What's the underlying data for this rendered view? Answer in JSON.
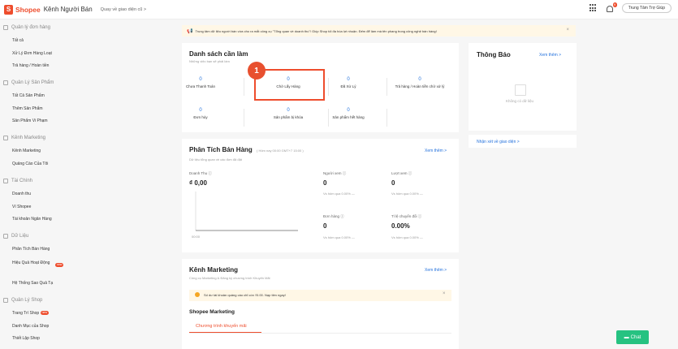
{
  "header": {
    "logo_mark": "S",
    "logo_text": "Shopee",
    "portal_name": "Kênh Người Bán",
    "back_link": "Quay về giao diện cũ >",
    "notification_count": "9",
    "help_label": "Trung Tâm Trợ Giúp"
  },
  "sidebar": {
    "sections": [
      {
        "title": "Quản lý đơn hàng",
        "items": [
          "Tất cả",
          "Xử Lý Đơn Hàng Loạt",
          "Trả hàng / Hoàn tiền"
        ]
      },
      {
        "title": "Quản Lý Sản Phẩm",
        "items": [
          "Tất Cả Sản Phẩm",
          "Thêm Sản Phẩm",
          "Sản Phẩm Vi Phạm"
        ]
      },
      {
        "title": "Kênh Marketing",
        "items": [
          "Kênh Marketing",
          "Quảng Cáo Của Tôi"
        ]
      },
      {
        "title": "Tài Chính",
        "items": [
          "Doanh thu",
          "Ví Shopee",
          "Tài khoản Ngân Hàng"
        ]
      },
      {
        "title": "Dữ Liệu",
        "items": [
          "Phân Tích Bán Hàng",
          "Hiệu Quả Hoạt Động",
          "Hệ Thống Sao Quả Tạ"
        ]
      },
      {
        "title": "Quản Lý Shop",
        "items": [
          "Trang Trí Shop",
          "Danh Mục của Shop",
          "Thiết Lập Shop"
        ]
      }
    ],
    "new_badge": "new"
  },
  "notice": {
    "text": "Trung tâm dữ liệu người bán vừa cho ra mắt công cụ \"Tổng quan về doanh thu\"! Giúp Shop tối đa hóa lợi nhuận. Đếm để làm mà tên phang trong công nghệ bán hàng!",
    "close": "×"
  },
  "todo": {
    "title": "Danh sách cần làm",
    "subtitle": "Những việc bạn sẽ phải làm",
    "stats": [
      {
        "value": "0",
        "label": "Chưa Thanh Toán"
      },
      {
        "value": "0",
        "label": "Chờ Lấy Hàng"
      },
      {
        "value": "0",
        "label": "Đã Xử Lý"
      },
      {
        "value": "0",
        "label": "Trả hàng / Hoàn tiền chờ xử lý"
      },
      {
        "value": "0",
        "label": "Đơn hủy"
      },
      {
        "value": "0",
        "label": "Sản phẩm bị khóa"
      },
      {
        "value": "0",
        "label": "Sản phẩm hết hàng"
      }
    ],
    "marker": "1"
  },
  "announcements": {
    "title": "Thông Báo",
    "more": "Xem thêm >",
    "empty": "Không có dữ liệu",
    "feedback_link": "Nhận xét về giao diện >"
  },
  "analytics": {
    "title": "Phân Tích Bán Hàng",
    "time_note": "( Hôm nay 00:00 GMT+7 15:00 )",
    "subtitle": "Dữ liệu tổng quan về các đơn đã đặt",
    "more": "Xem thêm >",
    "revenue_label": "Doanh Thu ⓘ",
    "revenue_value": "₫ 0,00",
    "visitors_label": "Người xem ⓘ",
    "visitors_value": "0",
    "visitors_cmp": "Vs hôm qua 0.00% —",
    "views_label": "Lượt xem ⓘ",
    "views_value": "0",
    "views_cmp": "Vs hôm qua 0.00% —",
    "orders_label": "Đơn hàng ⓘ",
    "orders_value": "0",
    "orders_cmp": "Vs hôm qua 0.00% —",
    "conversion_label": "Tỉ lệ chuyển đổi ⓘ",
    "conversion_value": "0.00%",
    "conversion_cmp": "Vs hôm qua 0.00% —",
    "axis_start": "00:00"
  },
  "marketing": {
    "title": "Kênh Marketing",
    "subtitle": "Công cụ Marketing & Đăng ký chương trình Khuyến Mãi",
    "more": "Xem thêm >",
    "alert": "Số dư tài khoản quảng cáo chỉ còn ₫0.00. Nạp tiền ngay!",
    "alert_close": "×",
    "section_title": "Shopee Marketing",
    "tab": "Chương trình khuyến mãi"
  },
  "chat": {
    "label": "Chat"
  }
}
